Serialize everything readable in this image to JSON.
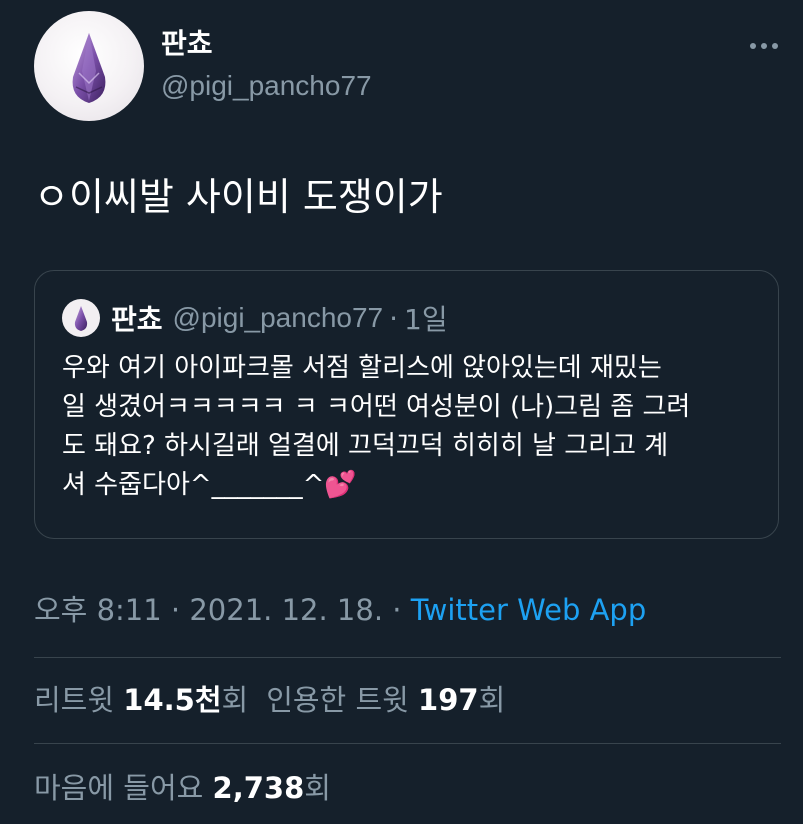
{
  "author": {
    "display_name": "판쵸",
    "handle": "@pigi_pancho77"
  },
  "tweet": {
    "text": "ㅇ이씨발 사이비 도쟁이가"
  },
  "quoted_tweet": {
    "display_name": "판쵸",
    "handle": "@pigi_pancho77",
    "separator": "·",
    "time": "1일",
    "lines": [
      "우와 여기 아이파크몰 서점 할리스에 앉아있는데 재밌는",
      "일 생겼어ㅋㅋㅋㅋㅋ ㅋ ㅋ어떤 여성분이 (나)그림 좀 그려",
      "도 돼요? 하시길래 얼결에 끄덕끄덕 히히히 날 그리고 계",
      "셔 수줍다아^_______^💕"
    ]
  },
  "meta": {
    "time": "오후 8:11",
    "separator": "·",
    "date": "2021. 12. 18.",
    "source": "Twitter Web App"
  },
  "stats": {
    "retweets_label": "리트윗",
    "retweets_count": "14.5천",
    "retweets_suffix": "회",
    "quotes_label": "인용한 트윗",
    "quotes_count": "197",
    "quotes_suffix": "회",
    "likes_label": "마음에 들어요",
    "likes_count": "2,738",
    "likes_suffix": "회"
  },
  "icons": {
    "avatar": "amethyst-gem-icon",
    "more": "more-horizontal-icon"
  },
  "colors": {
    "background": "#15202b",
    "text_primary": "#ffffff",
    "text_secondary": "#8899a6",
    "link": "#1da1f2",
    "border": "#38444d"
  }
}
